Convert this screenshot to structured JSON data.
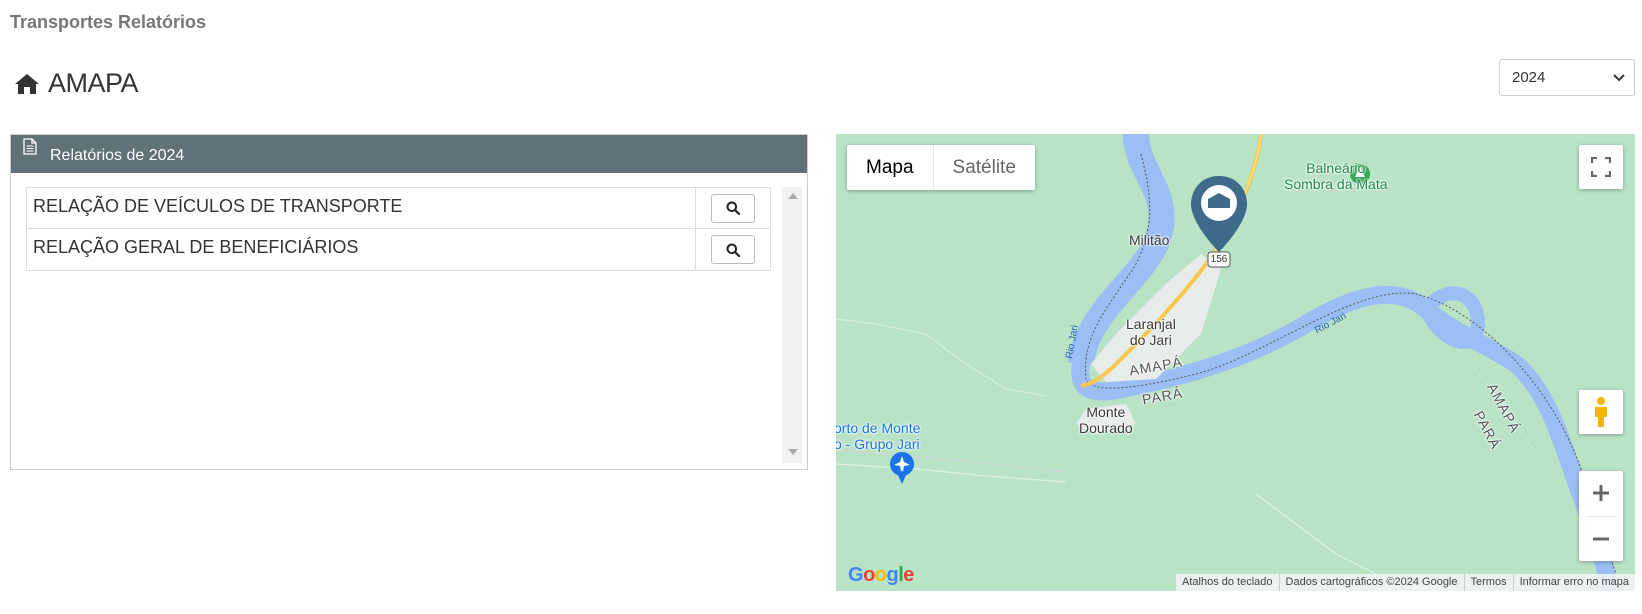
{
  "header": {
    "app_title": "Transportes Relatórios"
  },
  "page": {
    "title": "AMAPA",
    "title_icon": "home-icon"
  },
  "year_select": {
    "selected": "2024"
  },
  "reports_panel": {
    "heading": "Relatórios de 2024",
    "heading_icon": "document-icon",
    "items": [
      {
        "name": "RELAÇÃO DE VEÍCULOS DE TRANSPORTE",
        "action_icon": "search-icon"
      },
      {
        "name": "RELAÇÃO GERAL DE BENEFICIÁRIOS",
        "action_icon": "search-icon"
      }
    ]
  },
  "map": {
    "type_options": {
      "map": "Mapa",
      "satellite": "Satélite"
    },
    "labels": {
      "balneario_line1": "Balneário",
      "balneario_line2": "Sombra da Mata",
      "militao": "Militão",
      "laranjal_line1": "Laranjal",
      "laranjal_line2": "do Jari",
      "amapa_state": "AMAPÁ",
      "para_state": "PARÁ",
      "monte_line1": "Monte",
      "monte_line2": "Dourado",
      "airport_line1": "orto de Monte",
      "airport_line2": "o - Grupo Jari",
      "amapa_state_right": "AMAPÁ",
      "para_state_right": "PARÁ",
      "river1": "Rio Jari",
      "river2": "Rio Jari",
      "highway": "156"
    },
    "logo": "Google",
    "attribution": {
      "shortcuts": "Atalhos do teclado",
      "data": "Dados cartográficos ©2024 Google",
      "terms": "Termos",
      "report": "Informar erro no mapa"
    },
    "colors": {
      "land": "#b9e3c5",
      "water": "#9bbff4",
      "road": "#f6c84d",
      "marker": "#3f6a8a"
    }
  }
}
